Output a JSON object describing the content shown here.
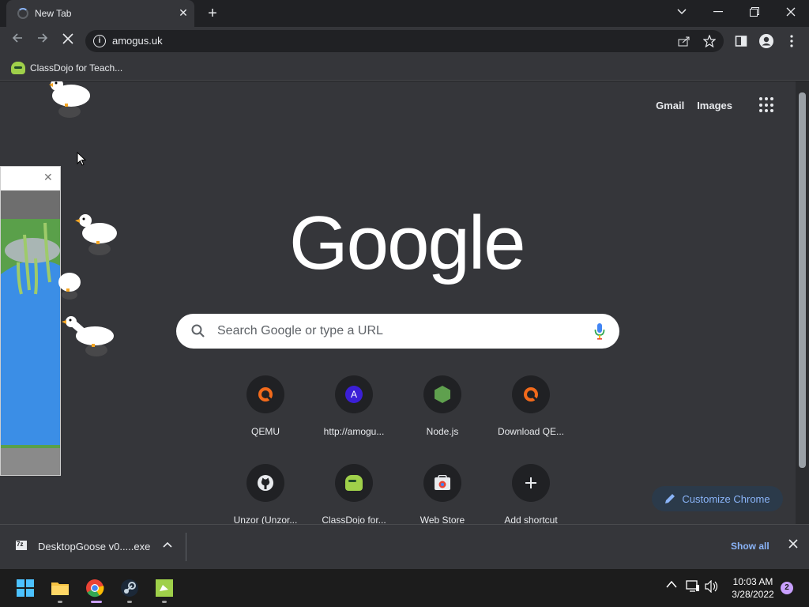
{
  "tab": {
    "title": "New Tab"
  },
  "omnibox": {
    "url": "amogus.uk"
  },
  "bookmarks": [
    {
      "label": "ClassDojo for Teach..."
    }
  ],
  "header_links": {
    "gmail": "Gmail",
    "images": "Images"
  },
  "logo_text": "Google",
  "search": {
    "placeholder": "Search Google or type a URL"
  },
  "shortcuts": [
    {
      "label": "QEMU",
      "icon": "qemu-icon"
    },
    {
      "label": "http://amogu...",
      "icon": "letter-a-icon",
      "letter": "A"
    },
    {
      "label": "Node.js",
      "icon": "nodejs-icon"
    },
    {
      "label": "Download QE...",
      "icon": "qemu-icon"
    },
    {
      "label": "Unzor (Unzor...",
      "icon": "github-icon"
    },
    {
      "label": "ClassDojo for...",
      "icon": "classdojo-icon"
    },
    {
      "label": "Web Store",
      "icon": "web-store-icon"
    },
    {
      "label": "Add shortcut",
      "icon": "plus-icon"
    }
  ],
  "customize_label": "Customize Chrome",
  "download": {
    "filename": "DesktopGoose v0.....exe",
    "show_all": "Show all"
  },
  "clock": {
    "time": "10:03 AM",
    "date": "3/28/2022"
  },
  "notification_count": "2",
  "colors": {
    "page_bg": "#35363a",
    "accent": "#8ab4f8",
    "taskbar": "#1c1c1c"
  }
}
